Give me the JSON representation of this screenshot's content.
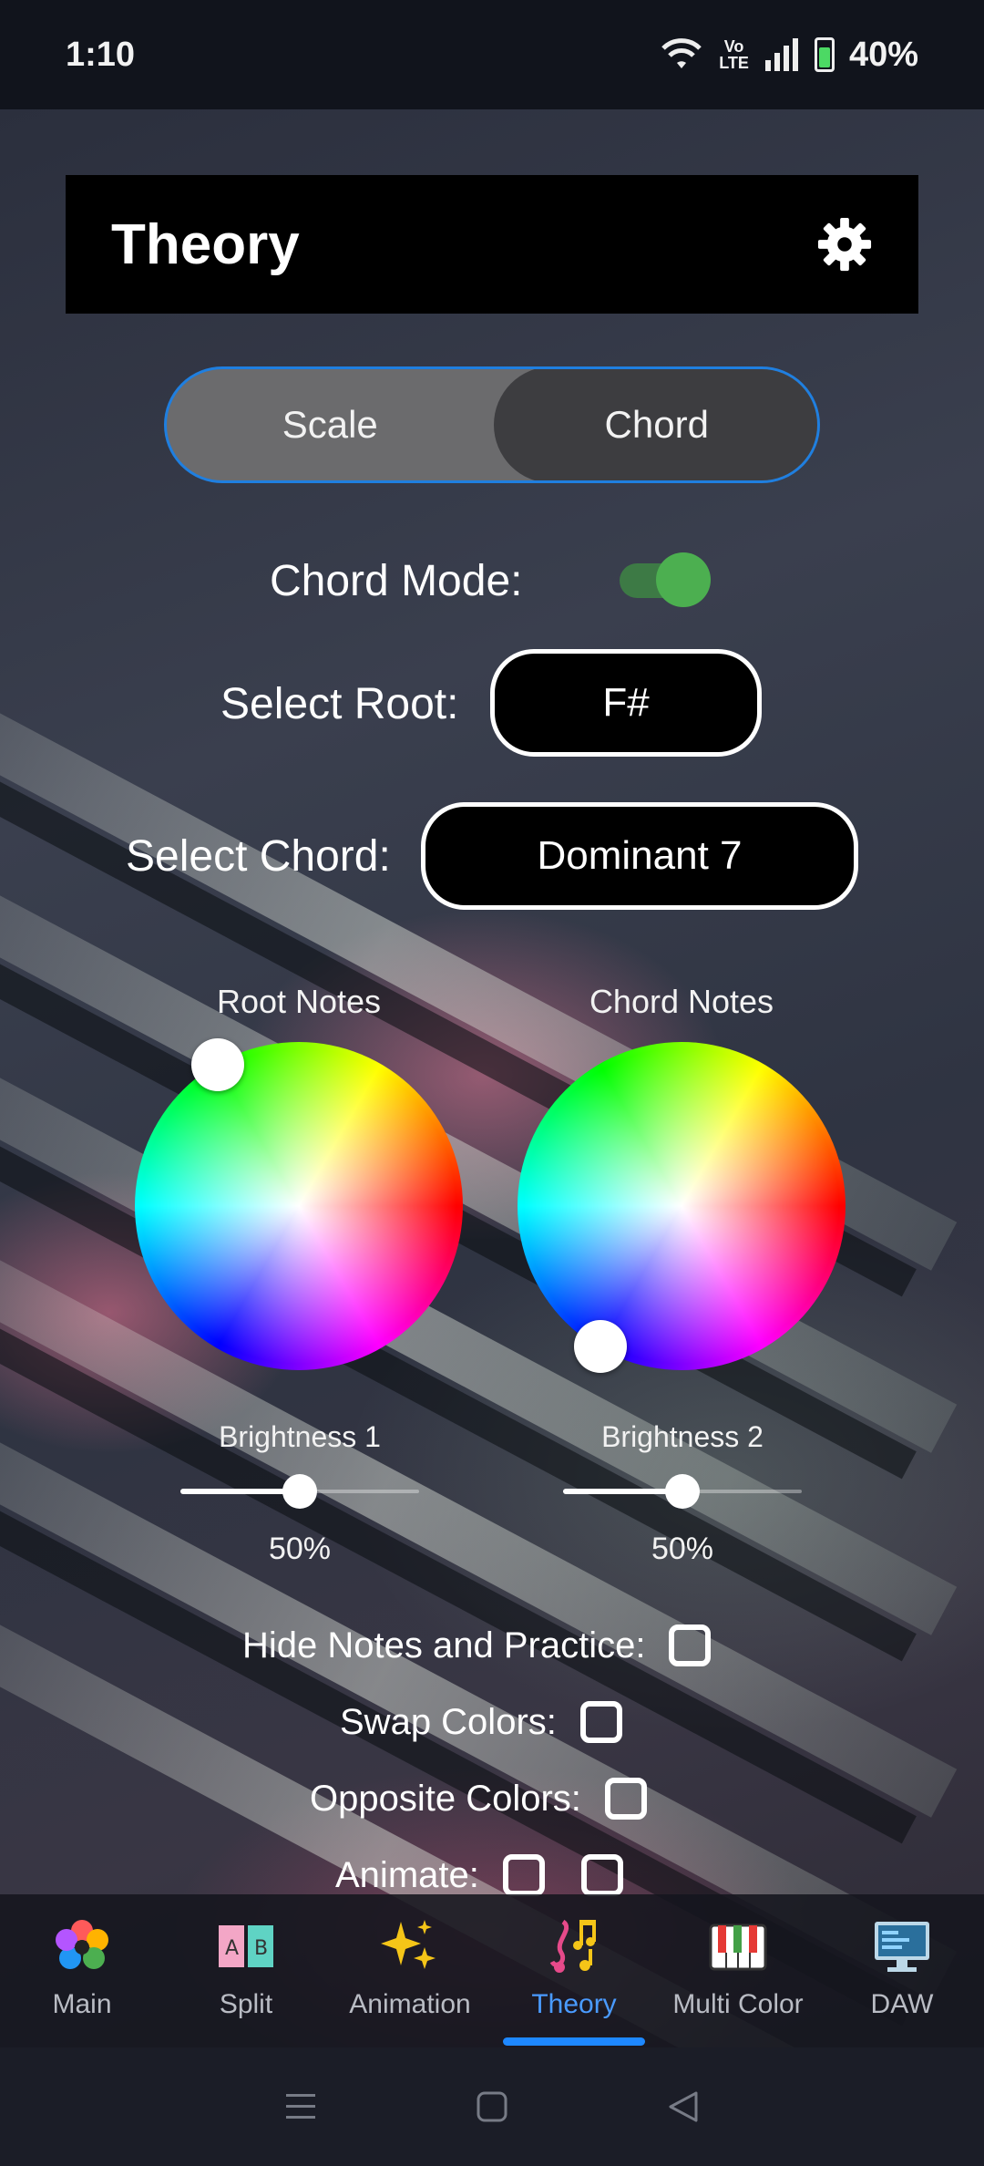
{
  "status_bar": {
    "time": "1:10",
    "volte_top": "Vo",
    "volte_bottom": "LTE",
    "battery": "40%"
  },
  "header": {
    "title": "Theory",
    "settings_icon": "gear-icon"
  },
  "segmented": {
    "options": [
      "Scale",
      "Chord"
    ],
    "selected": "Chord"
  },
  "chord_mode": {
    "label": "Chord Mode:",
    "enabled": true,
    "accent": "#4caf50"
  },
  "root": {
    "label": "Select Root:",
    "value": "F#"
  },
  "chord": {
    "label": "Select Chord:",
    "value": "Dominant 7"
  },
  "wheels": [
    {
      "label": "Root Notes"
    },
    {
      "label": "Chord Notes"
    }
  ],
  "brightness": [
    {
      "label": "Brightness 1",
      "value": "50%",
      "level": 0.5
    },
    {
      "label": "Brightness 2",
      "value": "50%",
      "level": 0.5
    }
  ],
  "options": {
    "hide_notes": "Hide Notes and Practice:",
    "swap_colors": "Swap Colors:",
    "opposite_colors": "Opposite Colors:",
    "animate": "Animate:"
  },
  "nav": [
    {
      "label": "Main",
      "icon": "flower-icon"
    },
    {
      "label": "Split",
      "icon": "ab-split-icon"
    },
    {
      "label": "Animation",
      "icon": "sparkles-icon"
    },
    {
      "label": "Theory",
      "icon": "music-notes-icon",
      "active": true
    },
    {
      "label": "Multi Color",
      "icon": "piano-keys-icon"
    },
    {
      "label": "DAW",
      "icon": "monitor-icon"
    }
  ],
  "colors": {
    "accent_blue": "#1e88ff",
    "toggle_green": "#4caf50",
    "header_bg": "#000000"
  }
}
